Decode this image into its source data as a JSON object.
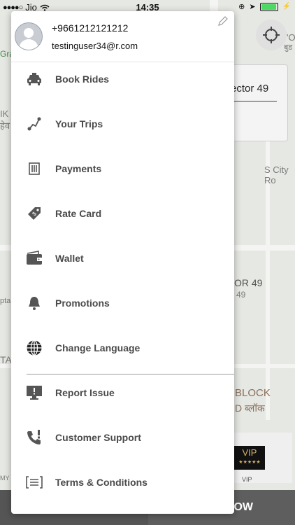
{
  "status_bar": {
    "carrier": "Jio",
    "time": "14:35"
  },
  "map": {
    "labels": {
      "sector": "ector 49",
      "s_city": "S City Ro",
      "or49": "OR 49",
      "num49": "49",
      "block": "BLOCK",
      "block_hindi": "D ब्लॉक",
      "ta": "TA",
      "left_k": "IK",
      "left_h": "हेव",
      "gra": "Gra",
      "ptal": "pta",
      "top_right": "'O",
      "top_right2": "बुड"
    },
    "vip": {
      "badge": "VIP",
      "stars": "★★★★★",
      "label": "VIP"
    },
    "left_bottom_label": "MY",
    "bottom_action": "OW"
  },
  "drawer": {
    "phone": "+9661212121212",
    "email": "testinguser34@r.com",
    "menu": [
      {
        "label": "Book Rides",
        "icon": "car-icon"
      },
      {
        "label": "Your Trips",
        "icon": "route-icon"
      },
      {
        "label": "Payments",
        "icon": "receipt-icon"
      },
      {
        "label": "Rate Card",
        "icon": "tag-icon"
      },
      {
        "label": "Wallet",
        "icon": "wallet-icon"
      },
      {
        "label": "Promotions",
        "icon": "bell-icon"
      },
      {
        "label": "Change Language",
        "icon": "globe-icon"
      },
      {
        "label": "Report Issue",
        "icon": "monitor-alert-icon"
      },
      {
        "label": "Customer Support",
        "icon": "phone-alert-icon"
      },
      {
        "label": "Terms & Conditions",
        "icon": "document-icon"
      }
    ]
  }
}
